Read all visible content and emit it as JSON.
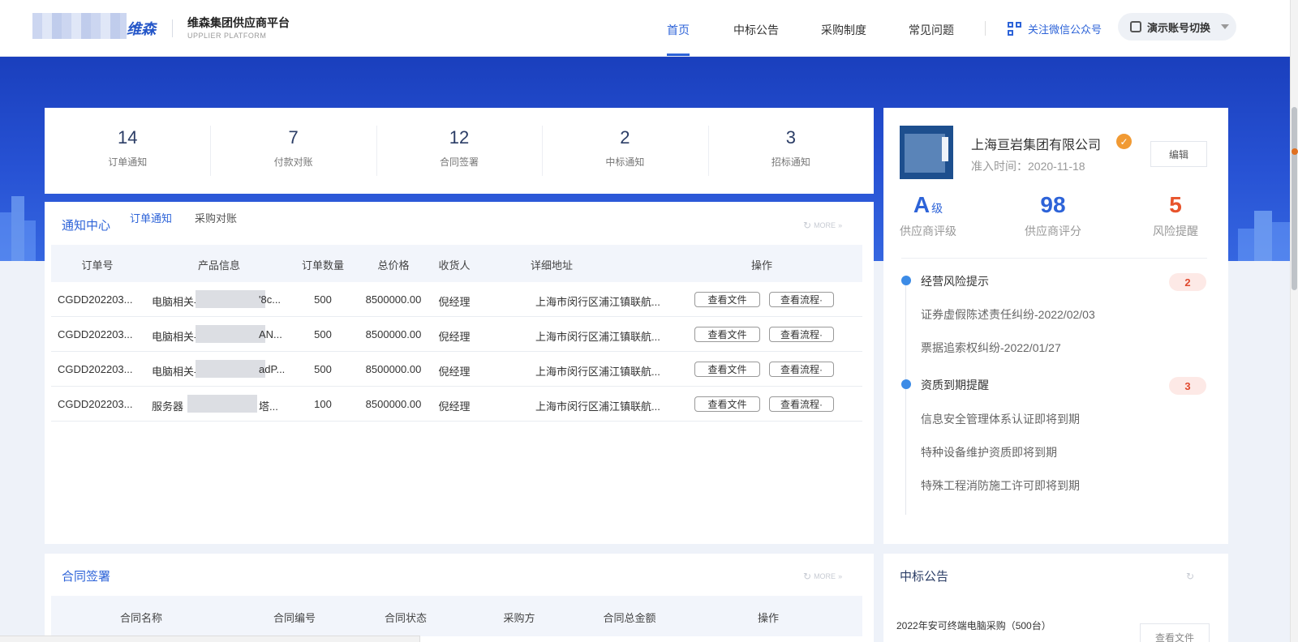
{
  "header": {
    "brand": "维森",
    "platform_title": "维森集团供应商平台",
    "platform_subtitle": "UPPLIER PLATFORM",
    "nav": [
      "首页",
      "中标公告",
      "采购制度",
      "常见问题"
    ],
    "wechat": "关注微信公众号",
    "account_switch": "演示账号切换"
  },
  "stats": [
    {
      "value": "14",
      "label": "订单通知"
    },
    {
      "value": "7",
      "label": "付款对账"
    },
    {
      "value": "12",
      "label": "合同签署"
    },
    {
      "value": "2",
      "label": "中标通知"
    },
    {
      "value": "3",
      "label": "招标通知"
    }
  ],
  "notice_center": {
    "title": "通知中心",
    "tabs": [
      "订单通知",
      "采购对账"
    ],
    "more": "MORE",
    "columns": [
      "订单号",
      "产品信息",
      "订单数量",
      "总价格",
      "收货人",
      "详细地址",
      "操作"
    ],
    "rows": [
      {
        "order_no": "CGDD202203...",
        "product_prefix": "电脑相关-",
        "product_suffix": "'8c...",
        "qty": "500",
        "price": "8500000.00",
        "receiver": "倪经理",
        "address": "上海市闵行区浦江镇联航..."
      },
      {
        "order_no": "CGDD202203...",
        "product_prefix": "电脑相关-",
        "product_suffix": "AN...",
        "qty": "500",
        "price": "8500000.00",
        "receiver": "倪经理",
        "address": "上海市闵行区浦江镇联航..."
      },
      {
        "order_no": "CGDD202203...",
        "product_prefix": "电脑相关-",
        "product_suffix": "adP...",
        "qty": "500",
        "price": "8500000.00",
        "receiver": "倪经理",
        "address": "上海市闵行区浦江镇联航..."
      },
      {
        "order_no": "CGDD202203...",
        "product_prefix": "服务器",
        "product_suffix": "塔...",
        "qty": "100",
        "price": "8500000.00",
        "receiver": "倪经理",
        "address": "上海市闵行区浦江镇联航..."
      }
    ],
    "actions": [
      "查看文件",
      "查看流程·"
    ]
  },
  "profile": {
    "company": "上海亘岩集团有限公司",
    "join_date": "准入时间：2020-11-18",
    "edit": "编辑",
    "metrics": [
      {
        "value": "A",
        "suffix": "级",
        "label": "供应商评级",
        "color": "#2d63d8"
      },
      {
        "value": "98",
        "suffix": "",
        "label": "供应商评分",
        "color": "#2d63d8"
      },
      {
        "value": "5",
        "suffix": "",
        "label": "风险提醒",
        "color": "#e8542c"
      }
    ],
    "sections": [
      {
        "title": "经营风险提示",
        "count": "2",
        "items": [
          "证券虚假陈述责任纠纷-2022/02/03",
          "票据追索权纠纷-2022/01/27"
        ]
      },
      {
        "title": "资质到期提醒",
        "count": "3",
        "items": [
          "信息安全管理体系认证即将到期",
          "特种设备维护资质即将到期",
          "特殊工程消防施工许可即将到期"
        ]
      }
    ]
  },
  "contract": {
    "title": "合同签署",
    "more": "MORE",
    "columns": [
      "合同名称",
      "合同编号",
      "合同状态",
      "采购方",
      "合同总金额",
      "操作"
    ]
  },
  "announcement": {
    "title": "中标公告",
    "item": "2022年安可终端电脑采购（500台）",
    "view_file": "查看文件"
  }
}
